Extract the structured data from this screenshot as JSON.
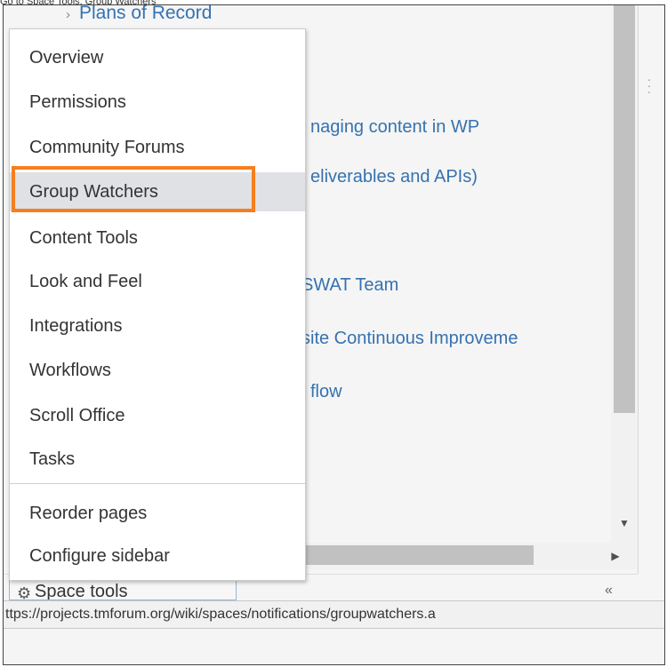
{
  "caption": "Go to Space Tools, Group Watchers",
  "breadcrumb": {
    "chevron": "›",
    "label": "Plans of Record"
  },
  "page_links": [
    "naging content in WP",
    "eliverables and APIs)",
    "SWAT Team",
    "site Continuous Improveme",
    "flow"
  ],
  "menu": {
    "items": [
      "Overview",
      "Permissions",
      "Community Forums",
      "Group Watchers",
      "Content Tools",
      "Look and Feel",
      "Integrations",
      "Workflows",
      "Scroll Office",
      "Tasks"
    ],
    "active": "Group Watchers",
    "secondary_items": [
      "Reorder pages",
      "Configure sidebar"
    ]
  },
  "highlight_color": "#f57f1f",
  "space_tools": {
    "label": "Space tools",
    "icon": "gear-icon"
  },
  "collapse_icon": "«",
  "status_url": "ttps://projects.tmforum.org/wiki/spaces/notifications/groupwatchers.a"
}
